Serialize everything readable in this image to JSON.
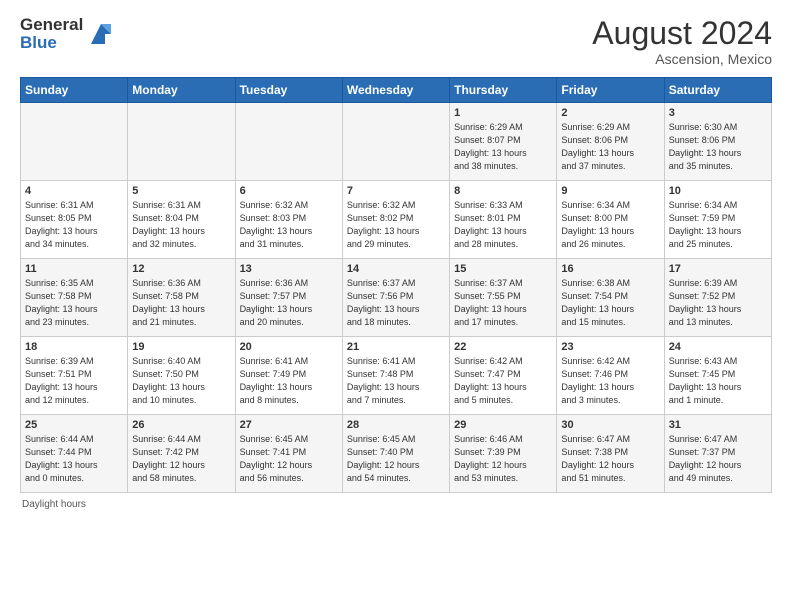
{
  "header": {
    "logo_general": "General",
    "logo_blue": "Blue",
    "month_year": "August 2024",
    "location": "Ascension, Mexico"
  },
  "days_of_week": [
    "Sunday",
    "Monday",
    "Tuesday",
    "Wednesday",
    "Thursday",
    "Friday",
    "Saturday"
  ],
  "weeks": [
    [
      {
        "day": "",
        "info": ""
      },
      {
        "day": "",
        "info": ""
      },
      {
        "day": "",
        "info": ""
      },
      {
        "day": "",
        "info": ""
      },
      {
        "day": "1",
        "info": "Sunrise: 6:29 AM\nSunset: 8:07 PM\nDaylight: 13 hours\nand 38 minutes."
      },
      {
        "day": "2",
        "info": "Sunrise: 6:29 AM\nSunset: 8:06 PM\nDaylight: 13 hours\nand 37 minutes."
      },
      {
        "day": "3",
        "info": "Sunrise: 6:30 AM\nSunset: 8:06 PM\nDaylight: 13 hours\nand 35 minutes."
      }
    ],
    [
      {
        "day": "4",
        "info": "Sunrise: 6:31 AM\nSunset: 8:05 PM\nDaylight: 13 hours\nand 34 minutes."
      },
      {
        "day": "5",
        "info": "Sunrise: 6:31 AM\nSunset: 8:04 PM\nDaylight: 13 hours\nand 32 minutes."
      },
      {
        "day": "6",
        "info": "Sunrise: 6:32 AM\nSunset: 8:03 PM\nDaylight: 13 hours\nand 31 minutes."
      },
      {
        "day": "7",
        "info": "Sunrise: 6:32 AM\nSunset: 8:02 PM\nDaylight: 13 hours\nand 29 minutes."
      },
      {
        "day": "8",
        "info": "Sunrise: 6:33 AM\nSunset: 8:01 PM\nDaylight: 13 hours\nand 28 minutes."
      },
      {
        "day": "9",
        "info": "Sunrise: 6:34 AM\nSunset: 8:00 PM\nDaylight: 13 hours\nand 26 minutes."
      },
      {
        "day": "10",
        "info": "Sunrise: 6:34 AM\nSunset: 7:59 PM\nDaylight: 13 hours\nand 25 minutes."
      }
    ],
    [
      {
        "day": "11",
        "info": "Sunrise: 6:35 AM\nSunset: 7:58 PM\nDaylight: 13 hours\nand 23 minutes."
      },
      {
        "day": "12",
        "info": "Sunrise: 6:36 AM\nSunset: 7:58 PM\nDaylight: 13 hours\nand 21 minutes."
      },
      {
        "day": "13",
        "info": "Sunrise: 6:36 AM\nSunset: 7:57 PM\nDaylight: 13 hours\nand 20 minutes."
      },
      {
        "day": "14",
        "info": "Sunrise: 6:37 AM\nSunset: 7:56 PM\nDaylight: 13 hours\nand 18 minutes."
      },
      {
        "day": "15",
        "info": "Sunrise: 6:37 AM\nSunset: 7:55 PM\nDaylight: 13 hours\nand 17 minutes."
      },
      {
        "day": "16",
        "info": "Sunrise: 6:38 AM\nSunset: 7:54 PM\nDaylight: 13 hours\nand 15 minutes."
      },
      {
        "day": "17",
        "info": "Sunrise: 6:39 AM\nSunset: 7:52 PM\nDaylight: 13 hours\nand 13 minutes."
      }
    ],
    [
      {
        "day": "18",
        "info": "Sunrise: 6:39 AM\nSunset: 7:51 PM\nDaylight: 13 hours\nand 12 minutes."
      },
      {
        "day": "19",
        "info": "Sunrise: 6:40 AM\nSunset: 7:50 PM\nDaylight: 13 hours\nand 10 minutes."
      },
      {
        "day": "20",
        "info": "Sunrise: 6:41 AM\nSunset: 7:49 PM\nDaylight: 13 hours\nand 8 minutes."
      },
      {
        "day": "21",
        "info": "Sunrise: 6:41 AM\nSunset: 7:48 PM\nDaylight: 13 hours\nand 7 minutes."
      },
      {
        "day": "22",
        "info": "Sunrise: 6:42 AM\nSunset: 7:47 PM\nDaylight: 13 hours\nand 5 minutes."
      },
      {
        "day": "23",
        "info": "Sunrise: 6:42 AM\nSunset: 7:46 PM\nDaylight: 13 hours\nand 3 minutes."
      },
      {
        "day": "24",
        "info": "Sunrise: 6:43 AM\nSunset: 7:45 PM\nDaylight: 13 hours\nand 1 minute."
      }
    ],
    [
      {
        "day": "25",
        "info": "Sunrise: 6:44 AM\nSunset: 7:44 PM\nDaylight: 13 hours\nand 0 minutes."
      },
      {
        "day": "26",
        "info": "Sunrise: 6:44 AM\nSunset: 7:42 PM\nDaylight: 12 hours\nand 58 minutes."
      },
      {
        "day": "27",
        "info": "Sunrise: 6:45 AM\nSunset: 7:41 PM\nDaylight: 12 hours\nand 56 minutes."
      },
      {
        "day": "28",
        "info": "Sunrise: 6:45 AM\nSunset: 7:40 PM\nDaylight: 12 hours\nand 54 minutes."
      },
      {
        "day": "29",
        "info": "Sunrise: 6:46 AM\nSunset: 7:39 PM\nDaylight: 12 hours\nand 53 minutes."
      },
      {
        "day": "30",
        "info": "Sunrise: 6:47 AM\nSunset: 7:38 PM\nDaylight: 12 hours\nand 51 minutes."
      },
      {
        "day": "31",
        "info": "Sunrise: 6:47 AM\nSunset: 7:37 PM\nDaylight: 12 hours\nand 49 minutes."
      }
    ]
  ],
  "footer": {
    "daylight_label": "Daylight hours"
  }
}
